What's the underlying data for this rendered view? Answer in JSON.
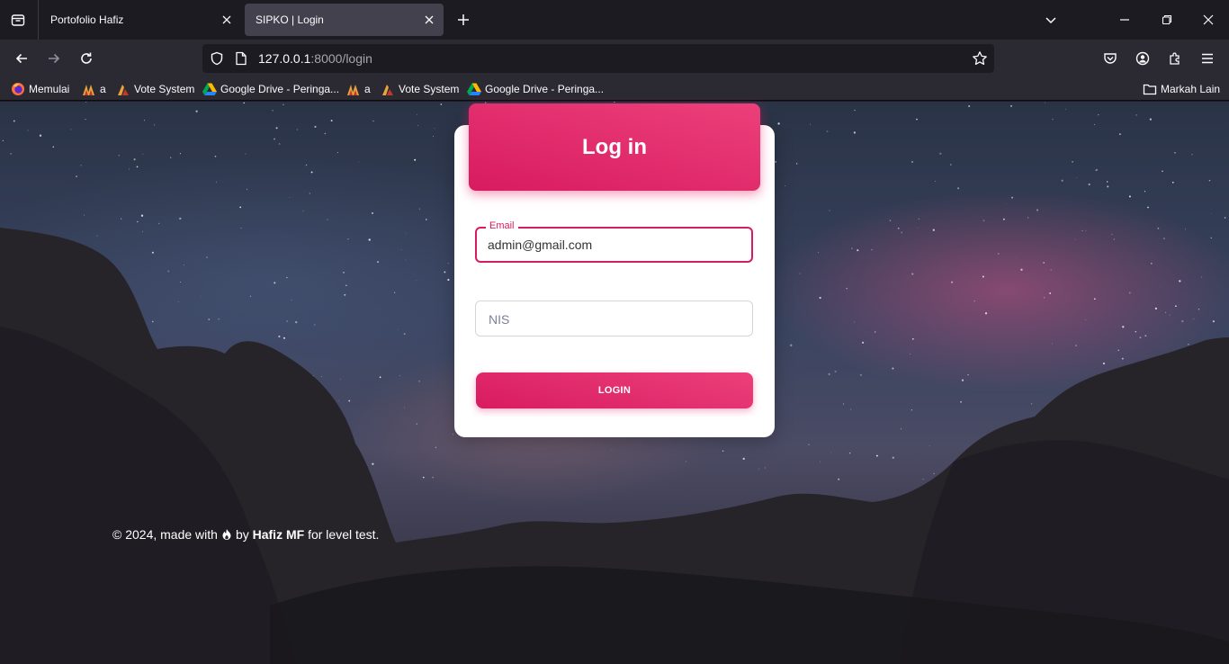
{
  "browser": {
    "tabs": [
      {
        "title": "Portofolio Hafiz",
        "active": false
      },
      {
        "title": "SIPKO | Login",
        "active": true
      }
    ],
    "url": {
      "host": "127.0.0.1",
      "rest": ":8000/login"
    },
    "bookmarks": [
      {
        "label": "Memulai",
        "icon": "firefox-icon"
      },
      {
        "label": "a",
        "icon": "bookmark-logo-icon"
      },
      {
        "label": "Vote System",
        "icon": "vote-icon"
      },
      {
        "label": "Google Drive - Peringa...",
        "icon": "google-drive-icon"
      },
      {
        "label": "a",
        "icon": "bookmark-logo-icon"
      },
      {
        "label": "Vote System",
        "icon": "vote-icon"
      },
      {
        "label": "Google Drive - Peringa...",
        "icon": "google-drive-icon"
      }
    ],
    "other_bookmarks": "Markah Lain"
  },
  "login": {
    "title": "Log in",
    "email_label": "Email",
    "email_value": "admin@gmail.com",
    "nis_placeholder": "NIS",
    "button": "LOGIN"
  },
  "footer": {
    "prefix": "© 2024, made with",
    "by": "by",
    "author": "Hafiz MF",
    "suffix": "for level test."
  },
  "colors": {
    "accent": "#e91e63",
    "accent_dark": "#d81b60"
  }
}
